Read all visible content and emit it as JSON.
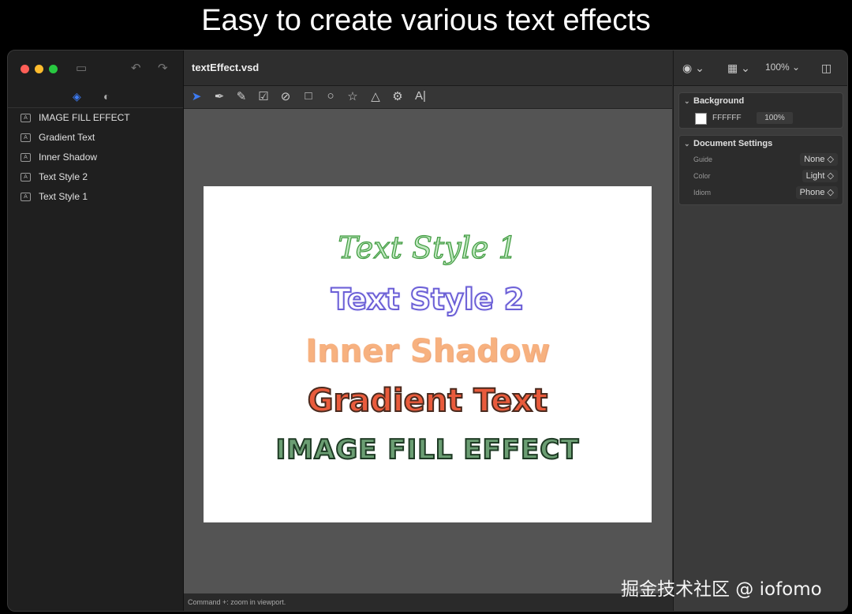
{
  "banner": {
    "text": "Easy to create various text effects"
  },
  "sidebar": {
    "layers": [
      {
        "label": "IMAGE FILL EFFECT"
      },
      {
        "label": "Gradient Text"
      },
      {
        "label": "Inner Shadow"
      },
      {
        "label": "Text Style 2"
      },
      {
        "label": "Text Style 1"
      }
    ]
  },
  "document": {
    "title": "textEffect.vsd"
  },
  "canvas": {
    "texts": [
      "Text Style 1",
      "Text Style 2",
      "Inner Shadow",
      "Gradient Text",
      "IMAGE FILL EFFECT"
    ]
  },
  "statusbar": {
    "text": "Command +: zoom in viewport."
  },
  "topright": {
    "zoom": "100%"
  },
  "inspector": {
    "background": {
      "title": "Background",
      "hex": "FFFFFF",
      "opacity": "100%"
    },
    "document_settings": {
      "title": "Document Settings",
      "rows": [
        {
          "label": "Guide",
          "value": "None ◇"
        },
        {
          "label": "Color",
          "value": "Light ◇"
        },
        {
          "label": "Idiom",
          "value": "Phone ◇"
        }
      ]
    }
  },
  "watermark": {
    "text": "掘金技术社区 @ iofomo"
  },
  "colors": {
    "accent": "#3d7bf2",
    "canvas_bg": "#FFFFFF",
    "workspace": "#545454"
  }
}
